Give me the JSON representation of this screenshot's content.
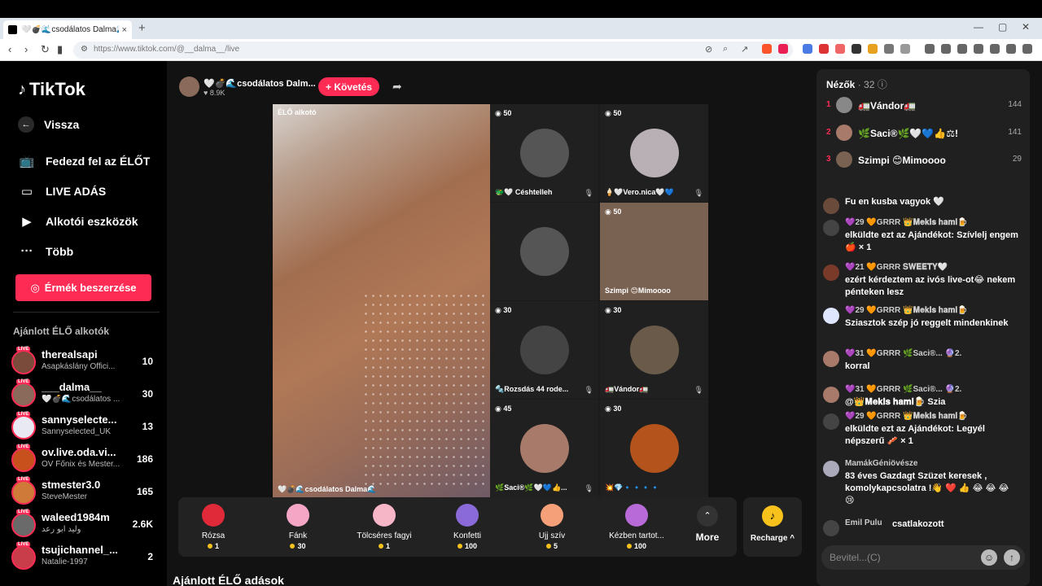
{
  "browser": {
    "tab_title": "🤍💣🌊csodálatos Dalma🌊",
    "tab_close": "×",
    "new_tab": "+",
    "url": "https://www.tiktok.com/@__dalma__/live"
  },
  "sidebar": {
    "logo": "TikTok",
    "back": "Vissza",
    "menu": [
      {
        "label": "Fedezd fel az ÉLŐT",
        "icon": "tv-icon"
      },
      {
        "label": "LIVE ADÁS",
        "icon": "camera-icon"
      },
      {
        "label": "Alkotói eszközök",
        "icon": "play-square-icon"
      },
      {
        "label": "Több",
        "icon": "more-icon"
      }
    ],
    "coin_button": "Érmék beszerzése",
    "recommended_heading": "Ajánlott ÉLŐ alkotók",
    "live_badge": "LIVE",
    "creators": [
      {
        "name": "therealsapi",
        "sub": "Asapkáslány Offici...",
        "count": "10",
        "color": "#7a4a3a"
      },
      {
        "name": "___dalma__",
        "sub": "🤍💣🌊csodálatos ...",
        "count": "30",
        "color": "#8a6a5a"
      },
      {
        "name": "sannyselecte...",
        "sub": "Sannyselected_UK",
        "count": "13",
        "color": "#e9e9f3"
      },
      {
        "name": "ov.live.oda.vi...",
        "sub": "OV Főnix és Mester...",
        "count": "186",
        "color": "#c8501c"
      },
      {
        "name": "stmester3.0",
        "sub": "SteveMester",
        "count": "165",
        "color": "#d07a3a"
      },
      {
        "name": "waleed1984m",
        "sub": "وليد ابو رعد",
        "count": "2.6K",
        "color": "#6a6a6a"
      },
      {
        "name": "tsujichannel_...",
        "sub": "Natalie-1997",
        "count": "2",
        "color": "#c93c4a"
      }
    ]
  },
  "host": {
    "name": "🤍💣🌊csodálatos Dalm...",
    "likes": "8.9K",
    "follow": "+ Követés"
  },
  "stage": {
    "main_label": "ÉLŐ alkotó",
    "main_caption": "🤍💣🌊csodálatos Dalma🌊",
    "guests": [
      {
        "badge": "50",
        "caption": "🐲🤍 Céshtelleh",
        "color": "#555"
      },
      {
        "badge": "50",
        "caption": "🍦🤍Vero.nica🤍💙",
        "color": "#b9b0b5"
      },
      {
        "badge": "",
        "caption": "",
        "color": "#3a3a3a"
      },
      {
        "badge": "50",
        "caption": "Szimpi 😊Mimoooo",
        "color": "#7a6252"
      },
      {
        "badge": "30",
        "caption": "🔩Rozsdás 44 rode...",
        "color": "#444"
      },
      {
        "badge": "30",
        "caption": "🚛Vándor🚛",
        "color": "#6a5a4a"
      },
      {
        "badge": "45",
        "caption": "🌿Saci®🌿🤍💙👍...",
        "color": "#a87a6a"
      },
      {
        "badge": "30",
        "caption": "💥💎🔹🔹🔹🔹",
        "color": "#b4531c"
      }
    ]
  },
  "gifts": [
    {
      "name": "Rózsa",
      "price": "1",
      "color": "#e02a3a"
    },
    {
      "name": "Fánk",
      "price": "30",
      "color": "#f4a6c4"
    },
    {
      "name": "Tölcséres fagyi",
      "price": "1",
      "color": "#f7b6c8"
    },
    {
      "name": "Konfetti",
      "price": "100",
      "color": "#8a6ad8"
    },
    {
      "name": "Ujj szív",
      "price": "5",
      "color": "#f6a07a"
    },
    {
      "name": "Kézben tartot...",
      "price": "100",
      "color": "#b86ad8"
    }
  ],
  "gifts_more": "More",
  "recharge": "Recharge ^",
  "recommended_streams_heading": "Ajánlott ÉLŐ adások",
  "chat": {
    "viewers_label": "Nézők",
    "viewers_count": "· 32",
    "top_viewers": [
      {
        "rank": "1",
        "name": "🚛Vándor🚛",
        "score": "144",
        "color": "#888"
      },
      {
        "rank": "2",
        "name": "🌿Saci®🌿🤍💙👍⚖!",
        "score": "141",
        "color": "#a87a6a"
      },
      {
        "rank": "3",
        "name": "Szimpi 😊Mimoooo",
        "score": "29",
        "color": "#7a6252"
      }
    ],
    "messages": [
      {
        "head": "",
        "text": "Fu en kusba vagyok 🤍",
        "color": "#6a4a3a"
      },
      {
        "head": "💜29 🧡GRRR 👑𝐌𝐞𝐤𝐢𝐬 𝐡𝐚𝐦𝐢🍺",
        "text": "elküldte ezt az Ajándékot: Szívlelj engem 🍎 × 1",
        "color": "#444"
      },
      {
        "head": "💜21 🧡GRRR 𝐒𝐖𝐄𝐄𝐓𝐘🤍",
        "text": "ezért kérdeztem az ivós live-ot😂 nekem pénteken lesz",
        "color": "#7a3a2a"
      },
      {
        "head": "💜29 🧡GRRR 👑𝐌𝐞𝐤𝐢𝐬 𝐡𝐚𝐦𝐢🍺",
        "text": "Sziasztok szép jó reggelt mindenkinek",
        "color": "#dfe6ff"
      },
      {
        "head": "💜31 🧡GRRR 🌿Saci®... 🔮2.",
        "text": "korral",
        "color": "#a87a6a"
      },
      {
        "head": "💜31 🧡GRRR 🌿Saci®... 🔮2.",
        "text": "@👑𝐌𝐞𝐤𝐢𝐬 𝐡𝐚𝐦𝐢🍺 Szia",
        "color": "#a87a6a"
      },
      {
        "head": "💜29 🧡GRRR 👑𝐌𝐞𝐤𝐢𝐬 𝐡𝐚𝐦𝐢🍺",
        "text": "elküldte ezt az Ajándékot: Legyél népszerű 🥓 × 1",
        "color": "#444"
      },
      {
        "head": "MamákGéniövésze",
        "text": "83 éves Gazdagt Szüzet keresek , komolykapcsolatra !👋 ❤️ 👍 😂 😂 😂 😢",
        "color": "#aab"
      },
      {
        "head": "Emil Pulu",
        "text": "csatlakozott",
        "color": "#444"
      }
    ],
    "input_placeholder": "Bevitel...(C)"
  }
}
